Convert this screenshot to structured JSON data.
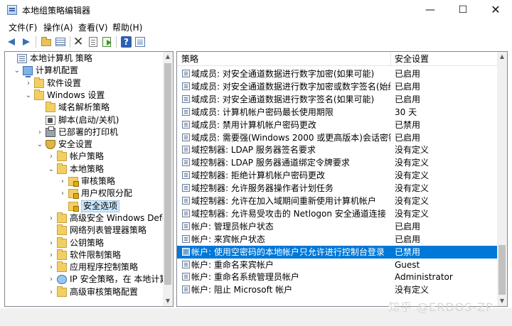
{
  "window": {
    "title": "本地组策略编辑器",
    "minimize_glyph": "—",
    "maximize_glyph": "☐",
    "close_glyph": "✕"
  },
  "menu": [
    "文件(F)",
    "操作(A)",
    "查看(V)",
    "帮助(H)"
  ],
  "toolbar": {
    "icons": [
      "back-arrow-icon",
      "forward-arrow-icon",
      "up-folder-icon",
      "show-hide-tree-icon",
      "delete-icon",
      "properties-icon",
      "export-list-icon",
      "help-icon",
      "extended-view-icon"
    ],
    "help_glyph": "?",
    "delete_glyph": "✕"
  },
  "tree": {
    "items": [
      {
        "label": "本地计算机 策略",
        "icon": "policy-icon",
        "expander": ""
      },
      {
        "label": "计算机配置",
        "icon": "computer-icon",
        "expander": "⌄"
      },
      {
        "label": "软件设置",
        "icon": "folder-icon",
        "expander": "›"
      },
      {
        "label": "Windows 设置",
        "icon": "folder-icon",
        "expander": "⌄"
      },
      {
        "label": "域名解析策略",
        "icon": "folder-icon",
        "expander": ""
      },
      {
        "label": "脚本(启动/关机)",
        "icon": "script-icon",
        "expander": ""
      },
      {
        "label": "已部署的打印机",
        "icon": "printer-icon",
        "expander": "›"
      },
      {
        "label": "安全设置",
        "icon": "shield-icon",
        "expander": "⌄"
      },
      {
        "label": "帐户策略",
        "icon": "folder-icon",
        "expander": "›"
      },
      {
        "label": "本地策略",
        "icon": "folder-icon",
        "expander": "⌄"
      },
      {
        "label": "审核策略",
        "icon": "lock-icon",
        "expander": "›"
      },
      {
        "label": "用户权限分配",
        "icon": "lock-icon",
        "expander": "›"
      },
      {
        "label": "安全选项",
        "icon": "lock-icon",
        "expander": ""
      },
      {
        "label": "高级安全 Windows Defende",
        "icon": "folder-icon",
        "expander": "›"
      },
      {
        "label": "网络列表管理器策略",
        "icon": "folder-icon",
        "expander": ""
      },
      {
        "label": "公钥策略",
        "icon": "folder-icon",
        "expander": "›"
      },
      {
        "label": "软件限制策略",
        "icon": "folder-icon",
        "expander": "›"
      },
      {
        "label": "应用程序控制策略",
        "icon": "folder-icon",
        "expander": "›"
      },
      {
        "label": "IP 安全策略，在 本地计算机",
        "icon": "network-icon",
        "expander": "›"
      },
      {
        "label": "高级审核策略配置",
        "icon": "folder-icon",
        "expander": "›"
      }
    ]
  },
  "list": {
    "columns": [
      "策略",
      "安全设置"
    ],
    "rows": [
      {
        "name": "域成员: 对安全通道数据进行数字加密(如果可能)",
        "value": "已启用"
      },
      {
        "name": "域成员: 对安全通道数据进行数字加密或数字签名(始终)",
        "value": "已启用"
      },
      {
        "name": "域成员: 对安全通道数据进行数字签名(如果可能)",
        "value": "已启用"
      },
      {
        "name": "域成员: 计算机帐户密码最长使用期限",
        "value": "30 天"
      },
      {
        "name": "域成员: 禁用计算机帐户密码更改",
        "value": "已禁用"
      },
      {
        "name": "域成员: 需要强(Windows 2000 或更高版本)会话密钥",
        "value": "已启用"
      },
      {
        "name": "域控制器: LDAP 服务器签名要求",
        "value": "没有定义"
      },
      {
        "name": "域控制器: LDAP 服务器通道绑定令牌要求",
        "value": "没有定义"
      },
      {
        "name": "域控制器: 拒绝计算机帐户密码更改",
        "value": "没有定义"
      },
      {
        "name": "域控制器: 允许服务器操作者计划任务",
        "value": "没有定义"
      },
      {
        "name": "域控制器:  允许在加入域期间重新使用计算机帐户",
        "value": "没有定义"
      },
      {
        "name": "域控制器:  允许易受攻击的 Netlogon 安全通道连接",
        "value": "没有定义"
      },
      {
        "name": "帐户: 管理员帐户状态",
        "value": "已启用"
      },
      {
        "name": "帐户: 来宾帐户状态",
        "value": "已启用"
      },
      {
        "name": "帐户: 使用空密码的本地帐户只允许进行控制台登录",
        "value": "已禁用",
        "selected": true
      },
      {
        "name": "帐户: 重命名来宾帐户",
        "value": "Guest"
      },
      {
        "name": "帐户: 重命名系统管理员帐户",
        "value": "Administrator"
      },
      {
        "name": "帐户: 阻止 Microsoft 帐户",
        "value": "没有定义"
      }
    ]
  },
  "watermark": "知乎 @ERDOS-ZP",
  "colors": {
    "selection": "#0078d7",
    "tree_selection": "#cce8ff"
  }
}
